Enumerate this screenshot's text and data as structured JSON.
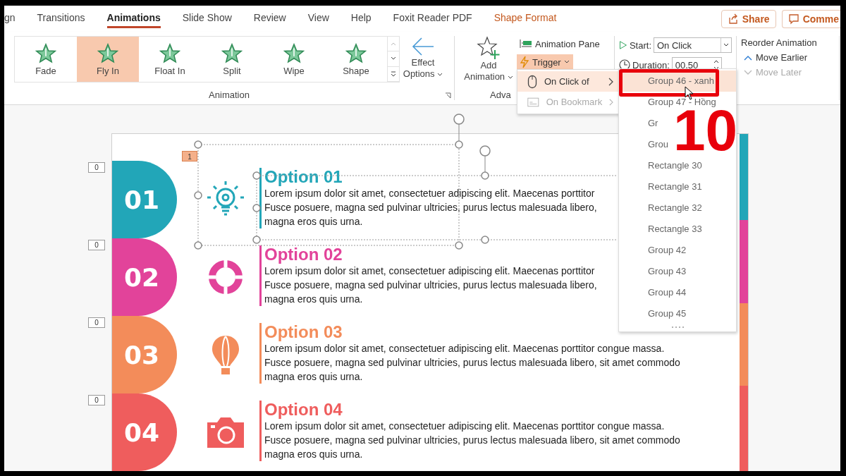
{
  "ribbon_tabs": [
    {
      "label": "gn",
      "selected": false,
      "kind": "normal"
    },
    {
      "label": "Transitions",
      "selected": false,
      "kind": "normal"
    },
    {
      "label": "Animations",
      "selected": true,
      "kind": "normal"
    },
    {
      "label": "Slide Show",
      "selected": false,
      "kind": "normal"
    },
    {
      "label": "Review",
      "selected": false,
      "kind": "normal"
    },
    {
      "label": "View",
      "selected": false,
      "kind": "normal"
    },
    {
      "label": "Help",
      "selected": false,
      "kind": "normal"
    },
    {
      "label": "Foxit Reader PDF",
      "selected": false,
      "kind": "normal"
    },
    {
      "label": "Shape Format",
      "selected": false,
      "kind": "contextual"
    }
  ],
  "share_button": {
    "label": "Share"
  },
  "comments_button": {
    "label": "Comme"
  },
  "animation_group": {
    "items": [
      {
        "label": "Fade",
        "selected": false
      },
      {
        "label": "Fly In",
        "selected": true
      },
      {
        "label": "Float In",
        "selected": false
      },
      {
        "label": "Split",
        "selected": false
      },
      {
        "label": "Wipe",
        "selected": false
      },
      {
        "label": "Shape",
        "selected": false
      }
    ],
    "effect_options": [
      "Effect",
      "Options"
    ],
    "group_label": "Animation"
  },
  "advanced_group": {
    "add_animation": [
      "Add",
      "Animation"
    ],
    "animation_pane": "Animation Pane",
    "trigger": {
      "label": "Trigger",
      "expanded": true
    },
    "group_label": "Adva"
  },
  "timing_group": {
    "start_label": "Start:",
    "start_value": "On Click",
    "duration_label": "Duration:",
    "duration_value": "00.50"
  },
  "reorder_group": {
    "title": "Reorder Animation",
    "items": [
      {
        "label": "Move Earlier",
        "disabled": false,
        "kind": "up"
      },
      {
        "label": "Move Later",
        "disabled": true,
        "kind": "down"
      }
    ]
  },
  "trigger_menu": {
    "items": [
      {
        "label": "On Click of",
        "selected": true,
        "disabled": false,
        "kind": "mouse"
      },
      {
        "label": "On Bookmark",
        "selected": false,
        "disabled": true,
        "kind": "bookmark"
      }
    ]
  },
  "trigger_submenu": {
    "items": [
      {
        "label": "Group 46 - xanh",
        "selected": true
      },
      {
        "label": "Group 47 - Hồng",
        "selected": false
      },
      {
        "label": "Gr",
        "selected": false
      },
      {
        "label": "Grou",
        "selected": false
      },
      {
        "label": "Rectangle 30",
        "selected": false
      },
      {
        "label": "Rectangle 31",
        "selected": false
      },
      {
        "label": "Rectangle 32",
        "selected": false
      },
      {
        "label": "Rectangle 33",
        "selected": false
      },
      {
        "label": "Group 42",
        "selected": false
      },
      {
        "label": "Group 43",
        "selected": false
      },
      {
        "label": "Group 44",
        "selected": false
      },
      {
        "label": "Group 45",
        "selected": false
      }
    ]
  },
  "annotation": {
    "number": "10"
  },
  "slide": {
    "animation_badge": "1",
    "options": [
      {
        "number": "01",
        "title": "Option 01",
        "color": "#22a6b8",
        "kind": "bulb",
        "marker": "0",
        "lines": [
          "Lorem ipsum dolor sit amet, consectetuer adipiscing elit. Maecenas porttitor",
          "Fusce posuere, magna sed pulvinar ultricies, purus lectus malesuada libero,",
          "magna eros quis urna."
        ]
      },
      {
        "number": "02",
        "title": "Option 02",
        "color": "#e2439a",
        "kind": "ring",
        "marker": "0",
        "lines": [
          "Lorem ipsum dolor sit amet, consectetuer adipiscing elit. Maecenas porttitor",
          "Fusce posuere, magna sed pulvinar ultricies, purus lectus malesuada libero,",
          "magna eros quis urna."
        ]
      },
      {
        "number": "03",
        "title": "Option 03",
        "color": "#f38c5a",
        "kind": "balloon",
        "marker": "0",
        "lines": [
          "Lorem ipsum dolor sit amet, consectetuer adipiscing elit. Maecenas porttitor congue massa.",
          "Fusce posuere, magna sed pulvinar ultricies, purus lectus malesuada libero, sit amet commodo",
          "magna eros quis urna."
        ]
      },
      {
        "number": "04",
        "title": "Option 04",
        "color": "#ef5d5d",
        "kind": "camera",
        "marker": "0",
        "lines": [
          "Lorem ipsum dolor sit amet, consectetuer adipiscing elit. Maecenas porttitor congue massa.",
          "Fusce posuere, magna sed pulvinar ultricies, purus lectus malesuada libero, sit amet commodo",
          "magna eros quis urna."
        ]
      }
    ]
  }
}
